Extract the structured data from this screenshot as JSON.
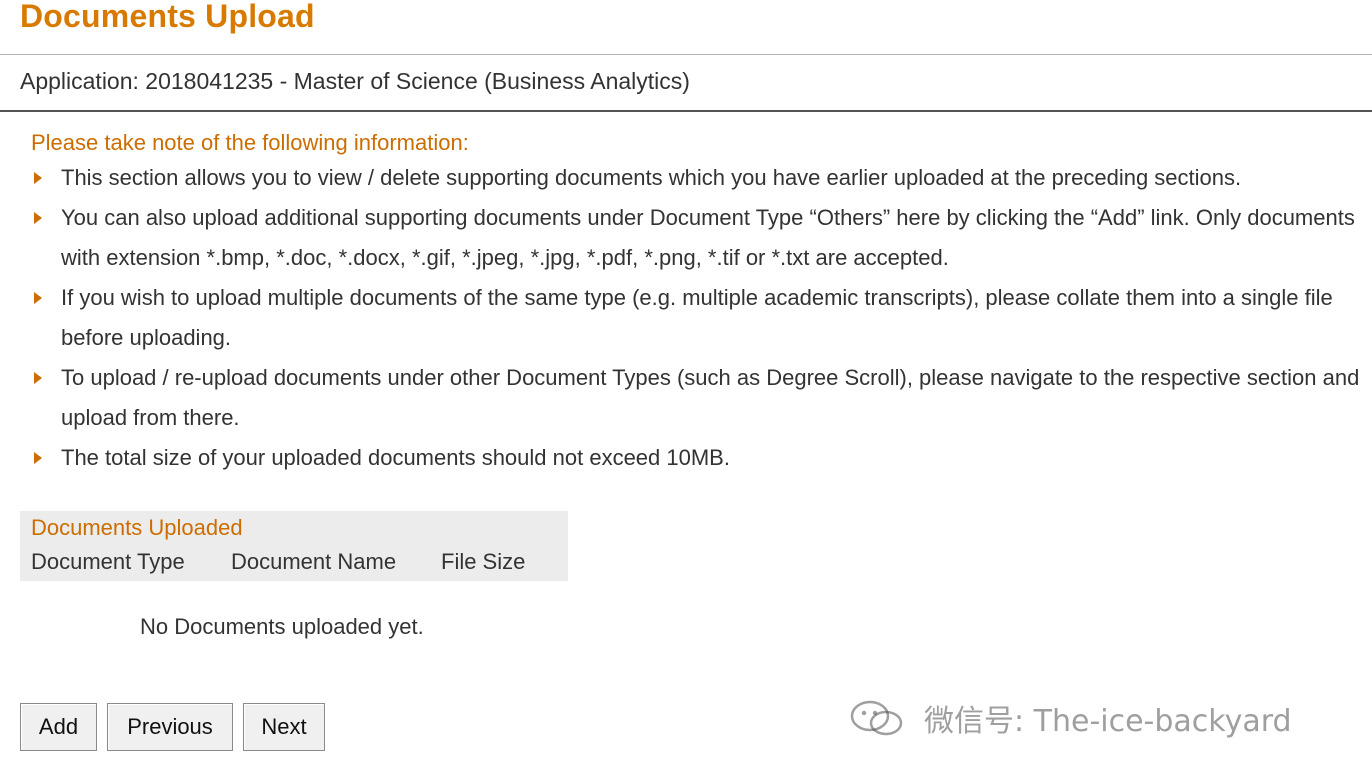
{
  "header": {
    "title": "Documents Upload",
    "application": "Application: 2018041235 - Master of Science (Business Analytics)"
  },
  "notes": {
    "heading": "Please take note of the following information:",
    "items": [
      "This section allows you to view / delete supporting documents which you have earlier uploaded at the preceding sections.",
      "You can also upload additional supporting documents under Document Type “Others” here by clicking the “Add” link. Only documents with extension *.bmp, *.doc, *.docx, *.gif, *.jpeg, *.jpg, *.pdf, *.png, *.tif or *.txt are accepted.",
      "If you wish to upload multiple documents of the same type (e.g. multiple academic transcripts), please collate them into a single file before uploading.",
      "To upload / re-upload documents under other Document Types (such as Degree Scroll), please navigate to the respective section and upload from there.",
      "The total size of your uploaded documents should not exceed 10MB."
    ]
  },
  "uploaded": {
    "heading": "Documents Uploaded",
    "columns": [
      "Document Type",
      "Document Name",
      "File Size"
    ],
    "empty_message": "No Documents uploaded yet."
  },
  "buttons": {
    "add": "Add",
    "previous": "Previous",
    "next": "Next"
  },
  "watermark": {
    "text": "微信号: The-ice-backyard",
    "icon": "wechat-icon"
  },
  "colors": {
    "accent": "#d97a00",
    "heading_orange": "#cc6d00",
    "text": "#333333",
    "table_header_bg": "#ececec"
  }
}
